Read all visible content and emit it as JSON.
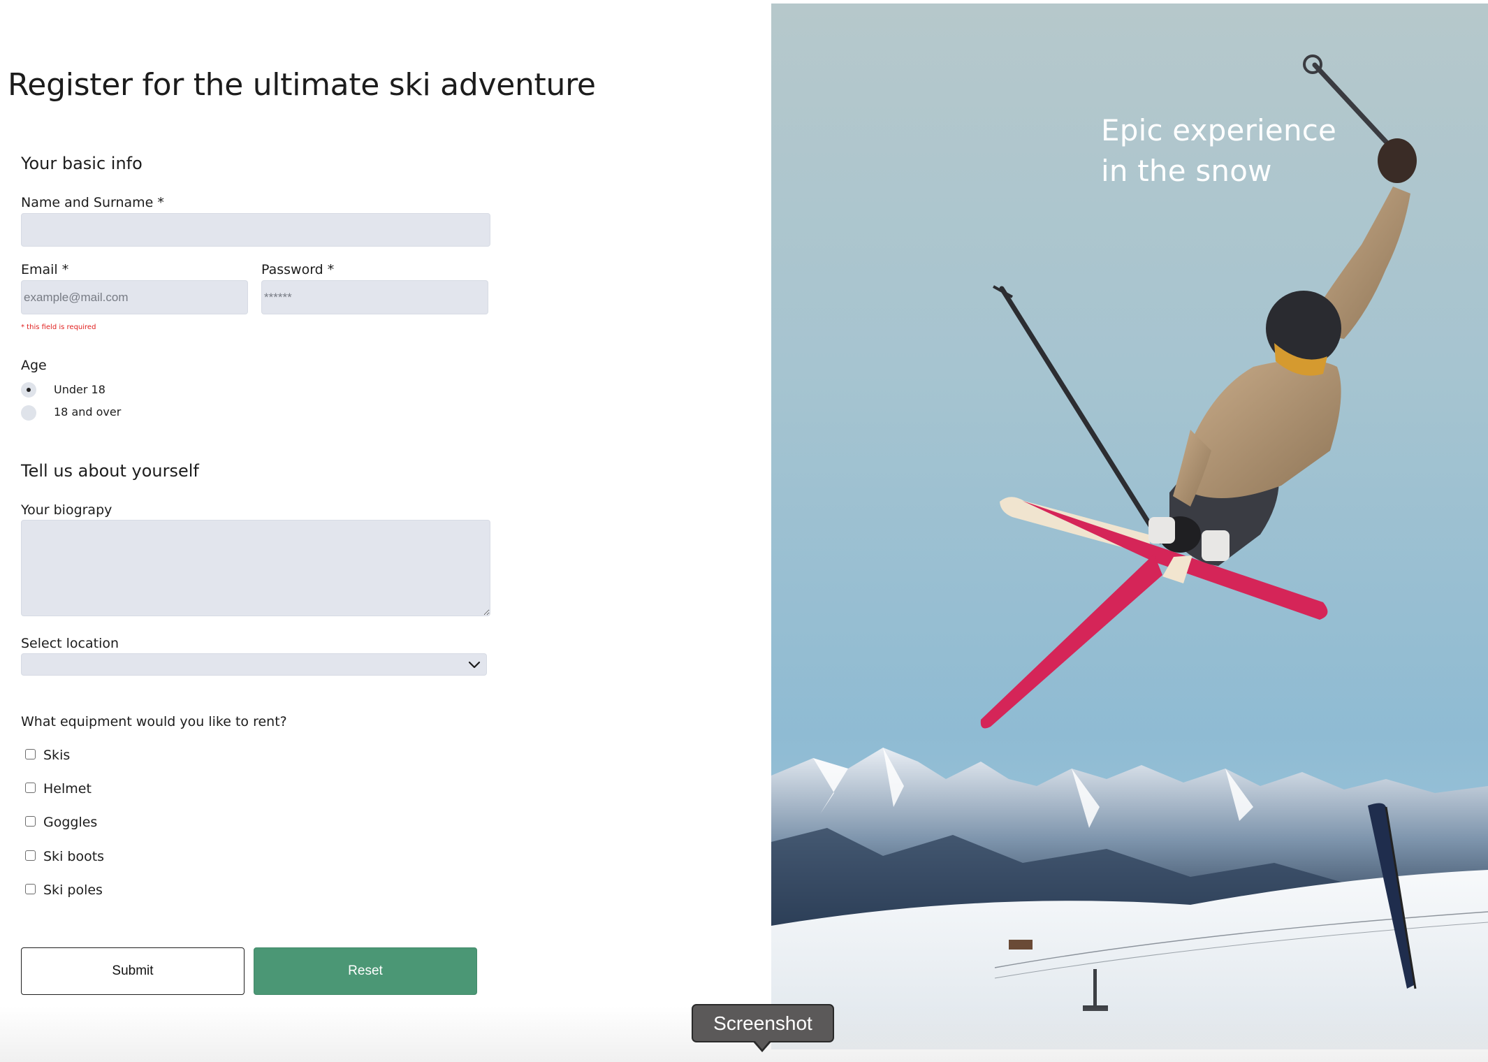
{
  "page_title": "Register for the ultimate ski adventure",
  "basic_info": {
    "title": "Your basic info",
    "name_label": "Name and Surname *",
    "name_value": "",
    "email_label": "Email *",
    "email_placeholder": "example@mail.com",
    "email_error": "* this field is required",
    "password_label": "Password *",
    "password_placeholder": "******"
  },
  "age": {
    "label": "Age",
    "options": [
      "Under 18",
      "18 and over"
    ],
    "selected": "Under 18"
  },
  "about": {
    "title": "Tell us about yourself",
    "bio_label": "Your biograpy",
    "bio_value": "",
    "location_label": "Select location",
    "location_value": ""
  },
  "equipment": {
    "question": "What equipment would you like to rent?",
    "items": [
      "Skis",
      "Helmet",
      "Goggles",
      "Ski boots",
      "Ski poles"
    ]
  },
  "buttons": {
    "submit": "Submit",
    "reset": "Reset"
  },
  "hero": {
    "caption_line1": "Epic experience",
    "caption_line2": "in the snow"
  },
  "tooltip": {
    "label": "Screenshot"
  },
  "colors": {
    "input_bg": "#e2e5ed",
    "error": "#e0201f",
    "reset_button": "#4b9775"
  }
}
